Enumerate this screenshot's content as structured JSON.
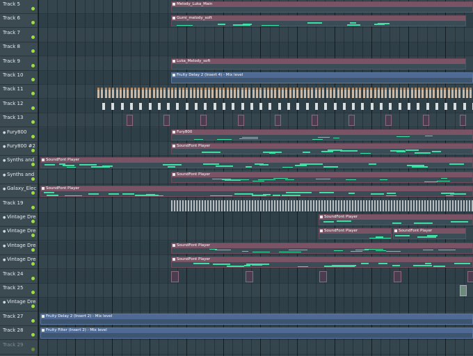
{
  "tracks": [
    {
      "label": "Track 5",
      "bullet": false,
      "dim": false
    },
    {
      "label": "Track 6",
      "bullet": false,
      "dim": false
    },
    {
      "label": "Track 7",
      "bullet": false,
      "dim": false
    },
    {
      "label": "Track 8",
      "bullet": false,
      "dim": false
    },
    {
      "label": "Track 9",
      "bullet": false,
      "dim": false
    },
    {
      "label": "Track 10",
      "bullet": false,
      "dim": false
    },
    {
      "label": "Track 11",
      "bullet": false,
      "dim": false
    },
    {
      "label": "Track 12",
      "bullet": false,
      "dim": false
    },
    {
      "label": "Track 13",
      "bullet": false,
      "dim": false
    },
    {
      "label": "Fury800",
      "bullet": true,
      "dim": false
    },
    {
      "label": "Fury800 #2",
      "bullet": true,
      "dim": false
    },
    {
      "label": "Synths and Keys",
      "bullet": true,
      "dim": false
    },
    {
      "label": "Synths and Key...",
      "bullet": true,
      "dim": false
    },
    {
      "label": "Galaxy_Electric...",
      "bullet": true,
      "dim": false
    },
    {
      "label": "Track 19",
      "bullet": false,
      "dim": false
    },
    {
      "label": "Vintage Dream...",
      "bullet": true,
      "dim": false
    },
    {
      "label": "Vintage Dream...",
      "bullet": true,
      "dim": false
    },
    {
      "label": "Vintage Dream...",
      "bullet": true,
      "dim": false
    },
    {
      "label": "Vintage Dream...",
      "bullet": true,
      "dim": false
    },
    {
      "label": "Track 24",
      "bullet": false,
      "dim": false
    },
    {
      "label": "Track 25",
      "bullet": false,
      "dim": false
    },
    {
      "label": "Vintage Dream...",
      "bullet": true,
      "dim": false
    },
    {
      "label": "Track 27",
      "bullet": false,
      "dim": false
    },
    {
      "label": "Track 28",
      "bullet": false,
      "dim": false
    },
    {
      "label": "Track 29",
      "bullet": false,
      "dim": true
    }
  ],
  "clips": {
    "melody_luka_main": "Melody_Luka_Main",
    "gumi_melody_soft": "Gumi_melody_soft",
    "luka_melody_soft": "Luka_Melody_soft",
    "fruity_delay_insert4": "Fruity Delay 2 (Insert 4) - Mix level",
    "fury800": "Fury800",
    "soundfont_player": "SoundFont Player",
    "fruity_delay_insert2": "Fruity Delay 2 (Insert 2) - Mix level",
    "fruity_filter_insert2": "Fruity Filter (Insert 2) - Mix level"
  },
  "colors": {
    "note": "#3fe0a3",
    "pattern_header": "#7a5365",
    "automation_header": "#4f6a95",
    "active_dot": "#9ee03b"
  }
}
